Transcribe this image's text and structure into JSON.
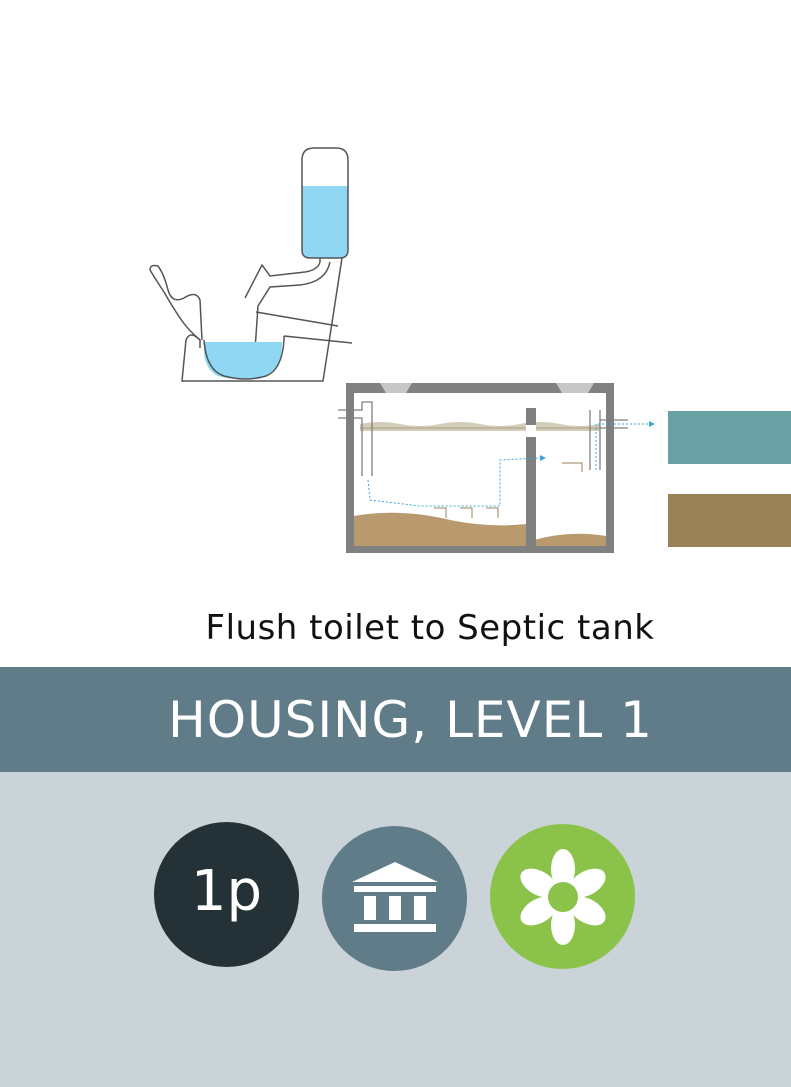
{
  "caption": "Flush toilet to Septic tank",
  "banner": {
    "title": "HOUSING, LEVEL 1"
  },
  "badges": [
    {
      "label": "1p",
      "color": "#243238",
      "icon": null
    },
    {
      "label": "",
      "color": "#607c89",
      "icon": "institution-icon"
    },
    {
      "label": "",
      "color": "#8bc34a",
      "icon": "flower-icon"
    }
  ],
  "colors": {
    "water": "#8fd7f2",
    "banner": "#607c89",
    "panel": "#cad3d8",
    "tank_wall": "#808080",
    "sludge": "#b89a6e",
    "effluent_band": "#68a0a4",
    "soil_band": "#9a8158",
    "flow_arrow": "#3aa6dc"
  }
}
